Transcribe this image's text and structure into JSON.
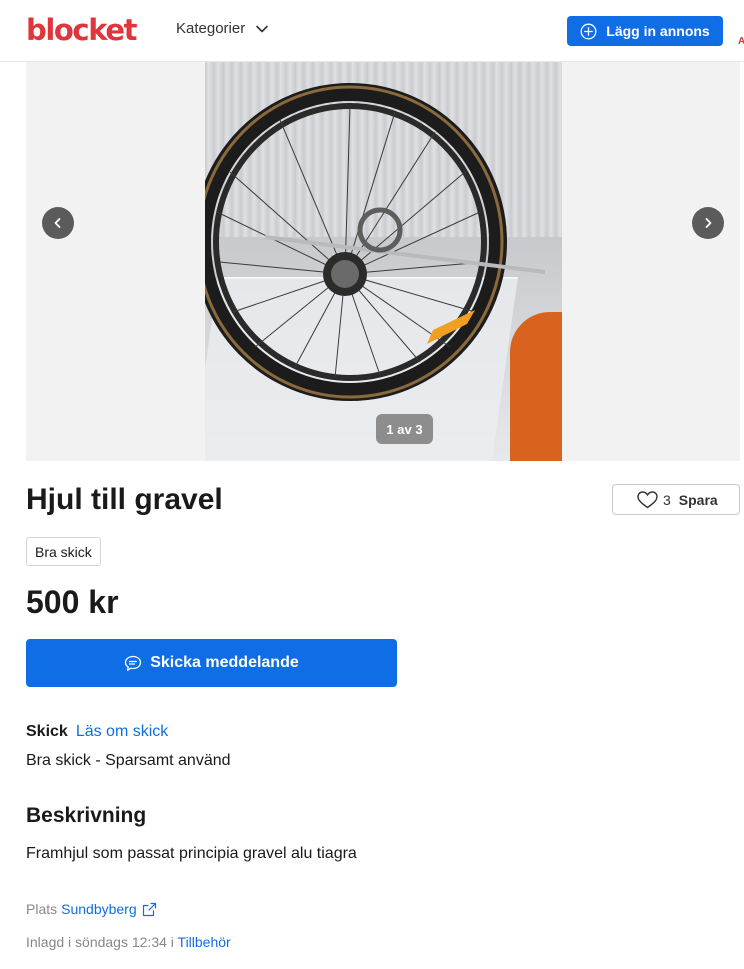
{
  "header": {
    "logo": "blocket",
    "categories_label": "Kategorier",
    "post_ad_label": "Lägg in annons",
    "edge_text": "A"
  },
  "gallery": {
    "counter": "1 av 3"
  },
  "listing": {
    "title": "Hjul till gravel",
    "save_count": "3",
    "save_label": "Spara",
    "condition_badge": "Bra skick",
    "price": "500 kr",
    "message_button": "Skicka meddelande",
    "condition_heading": "Skick",
    "condition_link": "Läs om skick",
    "condition_value": "Bra skick - Sparsamt använd",
    "description_heading": "Beskrivning",
    "description": "Framhjul som passat principia gravel alu tiagra",
    "location_label": "Plats",
    "location_value": "Sundbyberg",
    "posted_prefix": "Inlagd i söndags 12:34 i",
    "posted_category": "Tillbehör"
  },
  "colors": {
    "brand_red": "#e0353b",
    "primary_blue": "#0f6ee6"
  },
  "icons": [
    "chevron-down-icon",
    "plus-circle-icon",
    "chevron-left-icon",
    "chevron-right-icon",
    "heart-icon",
    "chat-bubble-icon",
    "external-link-icon"
  ]
}
